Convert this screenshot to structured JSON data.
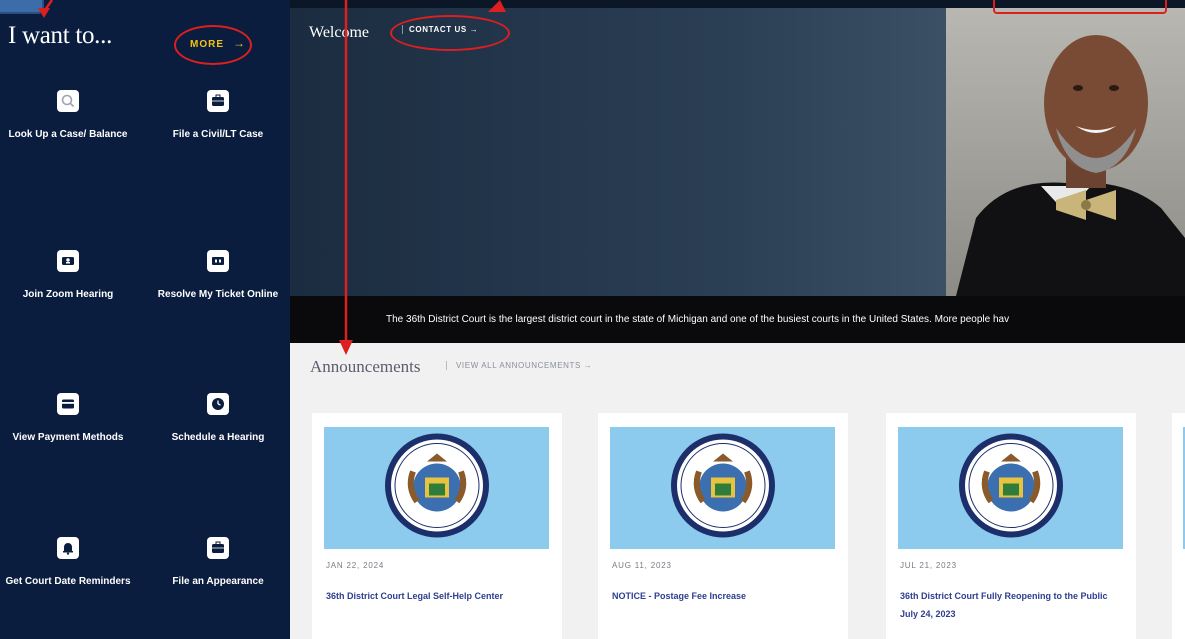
{
  "sidebar": {
    "title": "I want to...",
    "more_label": "MORE",
    "items": [
      {
        "label": "Look Up a Case/ Balance",
        "icon": "search-icon"
      },
      {
        "label": "File a Civil/LT Case",
        "icon": "briefcase-icon"
      },
      {
        "label": "Join Zoom Hearing",
        "icon": "video-icon"
      },
      {
        "label": "Resolve My Ticket Online",
        "icon": "ticket-icon"
      },
      {
        "label": "View Payment Methods",
        "icon": "credit-card-icon"
      },
      {
        "label": "Schedule a Hearing",
        "icon": "clock-icon"
      },
      {
        "label": "Get Court Date Reminders",
        "icon": "bell-icon"
      },
      {
        "label": "File an Appearance",
        "icon": "briefcase-icon"
      }
    ]
  },
  "hero": {
    "welcome": "Welcome",
    "contact_label": "CONTACT US",
    "marquee": "The 36th District Court is the largest district court in the state of Michigan and one of the busiest courts in the United States. More people hav"
  },
  "announcements": {
    "title": "Announcements",
    "view_all": "VIEW ALL ANNOUNCEMENTS",
    "cards": [
      {
        "date": "JAN 22, 2024",
        "title": "36th District Court Legal Self-Help Center"
      },
      {
        "date": "AUG 11, 2023",
        "title": "NOTICE - Postage Fee Increase"
      },
      {
        "date": "JUL 21, 2023",
        "title": "36th District Court Fully Reopening to the Public July 24, 2023"
      }
    ]
  },
  "colors": {
    "sidebar_bg": "#0b1d3f",
    "accent_yellow": "#f3c417",
    "announcement_title_blue": "#2d3e8f",
    "annotation_red": "#dc1f1f"
  }
}
